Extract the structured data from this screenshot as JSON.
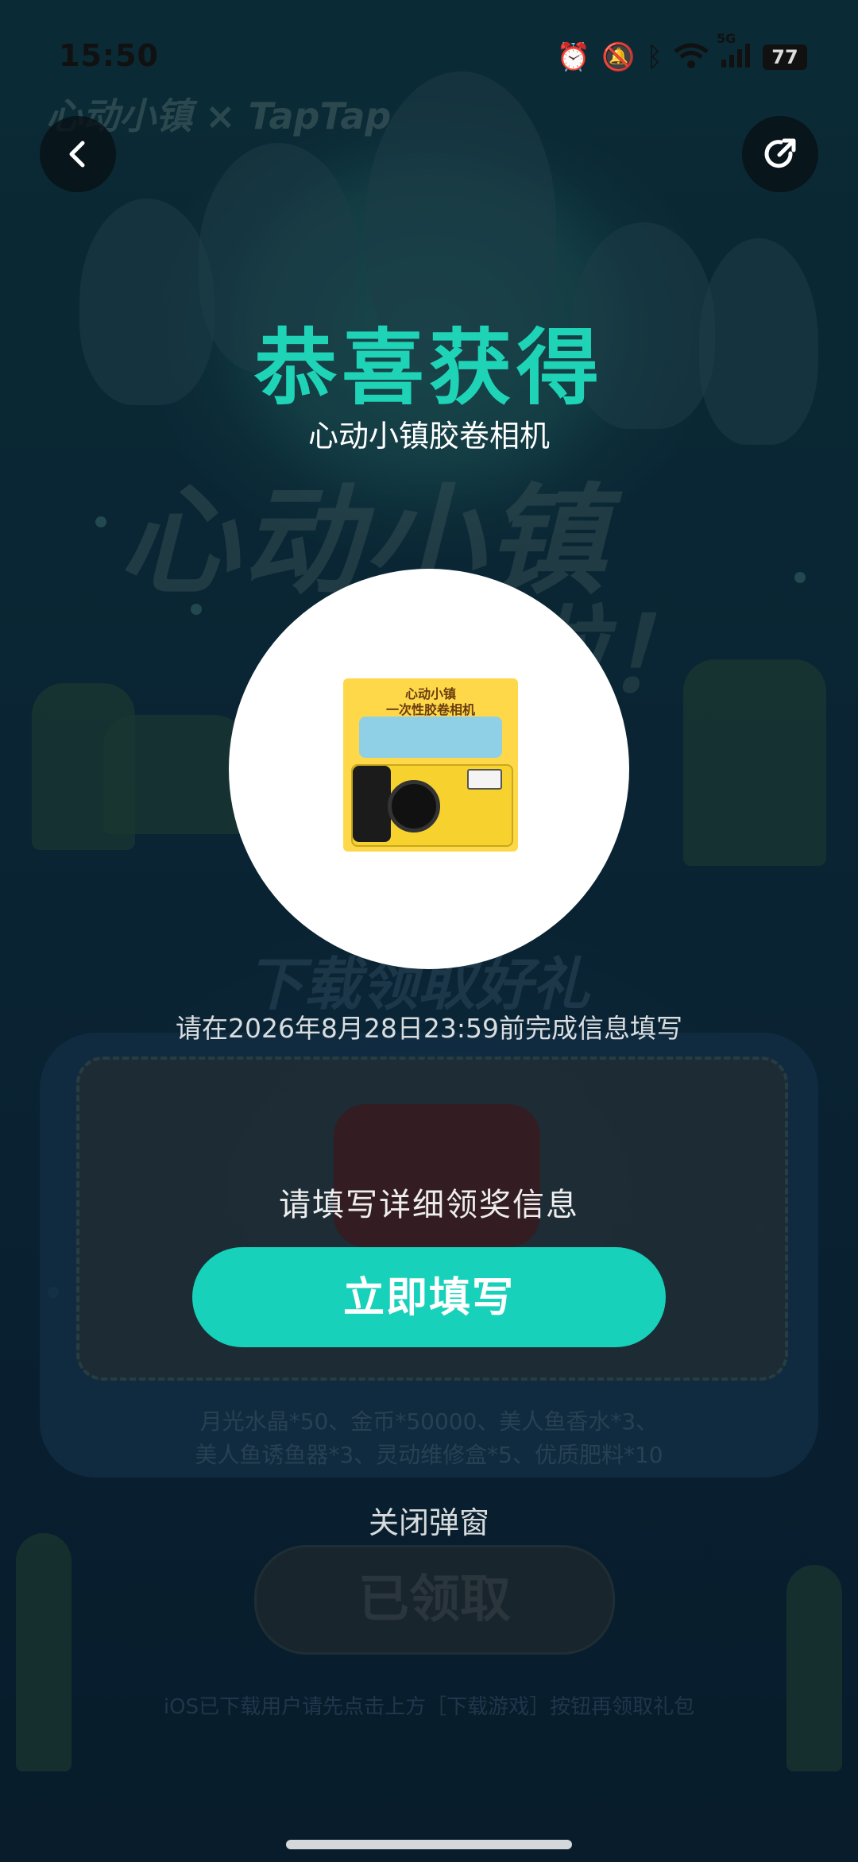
{
  "status_bar": {
    "time": "15:50",
    "signal_label": "5G",
    "battery": "77"
  },
  "background": {
    "logo": "心动小镇 × TapTap",
    "banner_line1": "心动小镇",
    "banner_line2": "啦！",
    "download_gift_title": "下载领取好礼",
    "prize_list_line1": "月光水晶*50、金币*50000、美人鱼香水*3、",
    "prize_list_line2": "美人鱼诱鱼器*3、灵动维修盒*5、优质肥料*10",
    "claimed_button": "已领取",
    "ios_tip": "iOS已下载用户请先点击上方［下载游戏］按钮再领取礼包"
  },
  "modal": {
    "title": "恭喜获得",
    "prize_name": "心动小镇胶卷相机",
    "prize_image_text_line1": "心动小镇",
    "prize_image_text_line2": "一次性胶卷相机",
    "deadline": "请在2026年8月28日23:59前完成信息填写",
    "fill_hint": "请填写详细领奖信息",
    "fill_button": "立即填写",
    "close_link": "关闭弹窗"
  },
  "colors": {
    "accent": "#1fd3b6",
    "button": "#17d1bb"
  }
}
